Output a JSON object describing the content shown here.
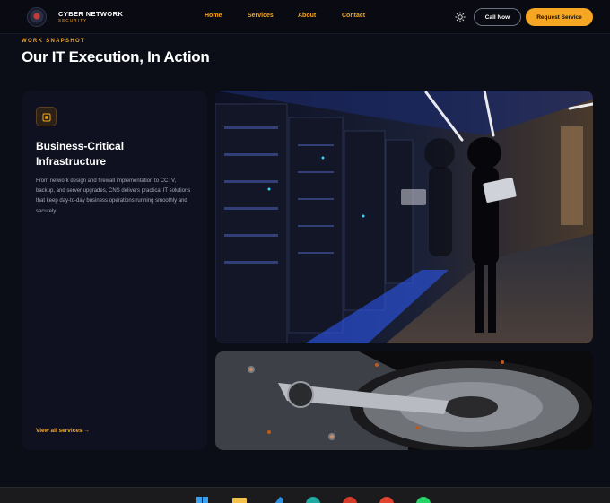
{
  "nav": {
    "brand_name": "CYBER NETWORK",
    "brand_sub": "SECURITY",
    "links": [
      "Home",
      "Services",
      "About",
      "Contact"
    ],
    "call_label": "Call Now",
    "request_label": "Request Service"
  },
  "hero": {
    "eyebrow": "WORK SNAPSHOT",
    "title": "Our IT Execution, In Action"
  },
  "card": {
    "title": "Business-Critical Infrastructure",
    "description": "From network design and firewall implementation to CCTV, backup, and server upgrades, CNS delivers practical IT solutions that keep day-to-day business operations running smoothly and securely.",
    "link_label": "View all services",
    "link_arrow": "→"
  },
  "taskbar": {
    "icons": [
      "windows-start-icon",
      "file-explorer-icon",
      "vscode-icon",
      "edge-icon",
      "app-icon",
      "chrome-icon",
      "whatsapp-icon"
    ]
  },
  "colors": {
    "accent": "#f5a623",
    "background": "#0b0d17",
    "card": "#0f1120"
  }
}
